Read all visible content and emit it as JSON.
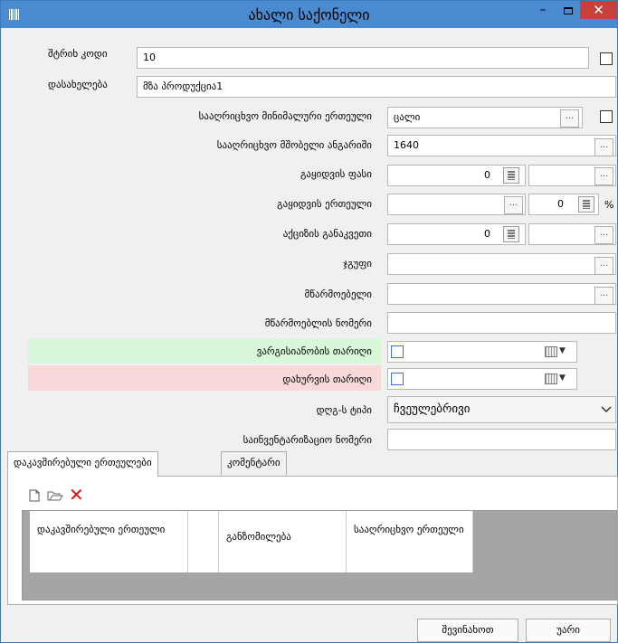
{
  "window": {
    "title": "ახალი საქონელი",
    "minimize_glyph": "–",
    "close_glyph": "✕"
  },
  "form": {
    "barcode": {
      "label": "შტრიხ კოდი",
      "value": "10"
    },
    "name": {
      "label": "დასახელება",
      "value": "მზა პროდუქცია1"
    },
    "min_unit": {
      "label": "სააღრიცხვო მინიმალური ერთეული",
      "value": "ცალი"
    },
    "parent_account": {
      "label": "სააღრიცხვო მშობელი ანგარიში",
      "value": "1640"
    },
    "sale_price": {
      "label": "გაყიდვის ფასი",
      "value": "0"
    },
    "sale_unit": {
      "label": "გაყიდვის ერთეული",
      "value": "0",
      "suffix": "%"
    },
    "excise_rate": {
      "label": "აქციზის განაკვეთი",
      "value": "0"
    },
    "group": {
      "label": "ჯგუფი",
      "value": ""
    },
    "manufacturer": {
      "label": "მწარმოებელი",
      "value": ""
    },
    "manufacturer_number": {
      "label": "მწარმოებლის ნომერი",
      "value": ""
    },
    "expiry_date": {
      "label": "ვარგისიანობის თარიღი",
      "color": "#d9f7d9"
    },
    "closing_date": {
      "label": "დახურვის თარიღი",
      "color": "#f7d9d9"
    },
    "vat_type": {
      "label": "დღგ-ს ტიპი",
      "value": "ჩვეულებრივი"
    },
    "inventory_number": {
      "label": "საინვენტარიზაციო ნომერი",
      "value": ""
    },
    "ellipsis": "..."
  },
  "tabs": [
    {
      "label": "დაკავშირებული ერთეულები"
    },
    {
      "label": "კომენტარი"
    }
  ],
  "toolbar": {
    "new_icon": "new-document-icon",
    "open_icon": "open-folder-icon",
    "delete_icon": "delete-x-icon"
  },
  "grid": {
    "columns": [
      "დაკავშირებული ერთეული",
      "",
      "განზომილება",
      "სააღრიცხვო ერთეული"
    ]
  },
  "footer": {
    "save_label": "შევინახოთ",
    "cancel_label": "უარი"
  }
}
